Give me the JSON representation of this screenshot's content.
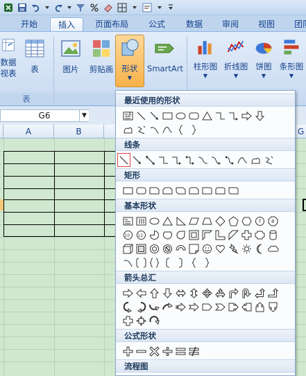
{
  "tabs": [
    {
      "label": "开始"
    },
    {
      "label": "插入"
    },
    {
      "label": "页面布局"
    },
    {
      "label": "公式"
    },
    {
      "label": "数据"
    },
    {
      "label": "审阅"
    },
    {
      "label": "视图"
    },
    {
      "label": "团队"
    }
  ],
  "active_tab": "插入",
  "ribbon": {
    "buttons": [
      {
        "label": "数据",
        "sublabel": "视表",
        "icon": "pivot-table-icon"
      },
      {
        "label": "表",
        "icon": "table-icon"
      },
      {
        "label": "图片",
        "icon": "picture-icon"
      },
      {
        "label": "剪贴画",
        "icon": "clipart-icon"
      },
      {
        "label": "形状",
        "icon": "shapes-icon"
      },
      {
        "label": "SmartArt",
        "icon": "smartart-icon"
      },
      {
        "label": "柱形图",
        "icon": "column-chart-icon"
      },
      {
        "label": "折线图",
        "icon": "line-chart-icon"
      },
      {
        "label": "饼图",
        "icon": "pie-chart-icon"
      },
      {
        "label": "条形图",
        "icon": "bar-chart-icon"
      }
    ],
    "groups": [
      {
        "label": "表"
      },
      {
        "label": "插"
      }
    ]
  },
  "formula_bar": {
    "name_box": "G6"
  },
  "columns": [
    "A",
    "B",
    "G"
  ],
  "shapes_menu": {
    "sections": [
      {
        "title": "最近使用的形状"
      },
      {
        "title": "线条"
      },
      {
        "title": "矩形"
      },
      {
        "title": "基本形状"
      },
      {
        "title": "箭头总汇"
      },
      {
        "title": "公式形状"
      },
      {
        "title": "流程图"
      }
    ]
  },
  "colors": {
    "ribbon_bg": "#d2e1f4",
    "tab_text": "#15428b",
    "sheet_bg": "#cfe8cf",
    "selected_outline": "#e04545",
    "pressed_button": "#f8b24a"
  }
}
